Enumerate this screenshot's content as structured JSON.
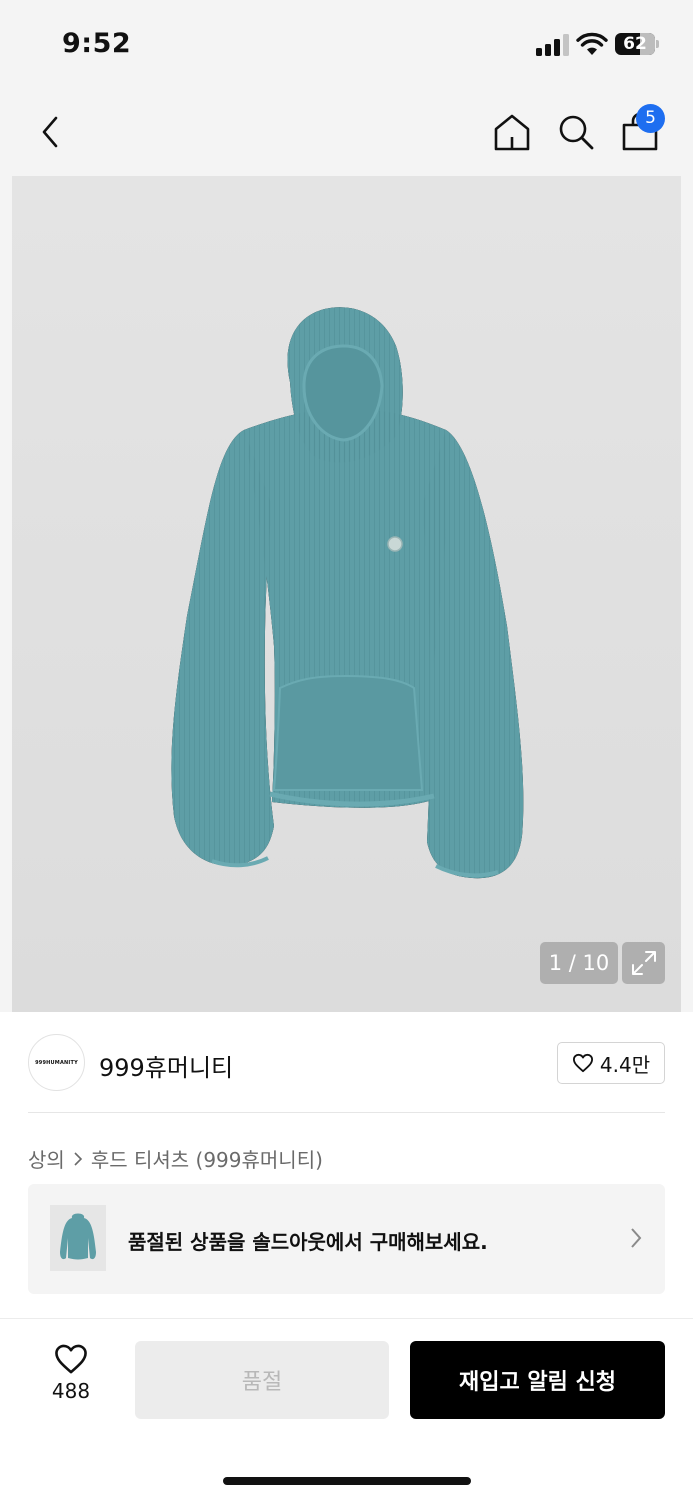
{
  "status_bar": {
    "time": "9:52",
    "battery_level": "62",
    "battery_fraction": 0.62
  },
  "nav": {
    "cart_count": "5"
  },
  "product": {
    "image_counter": "1 / 10",
    "garment_color": "#5e9ea6"
  },
  "brand": {
    "logo_text": "999HUMANITY",
    "name": "999휴머니티",
    "likes": "4.4만"
  },
  "breadcrumb": {
    "category": "상의",
    "subcategory": "후드 티셔츠 (999휴머니티)"
  },
  "soldout_banner": {
    "text": "품절된 상품을 솔드아웃에서 구매해보세요."
  },
  "bottom_bar": {
    "wish_count": "488",
    "soldout_label": "품절",
    "restock_label": "재입고 알림 신청"
  },
  "colors": {
    "accent_badge": "#1e6ef0",
    "primary_button": "#000000"
  }
}
